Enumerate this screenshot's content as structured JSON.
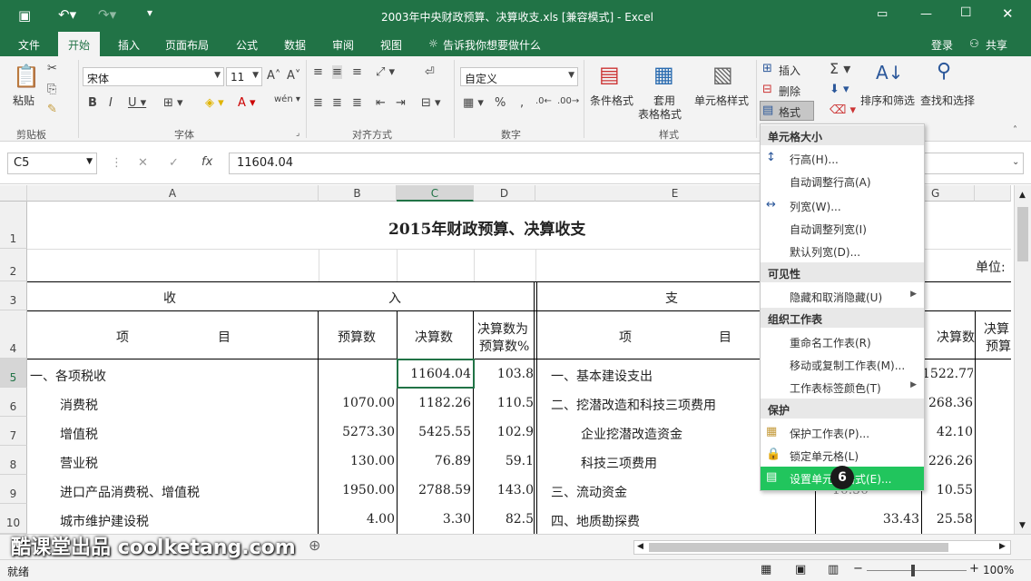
{
  "window": {
    "title": "2003年中央财政预算、决算收支.xls  [兼容模式] - Excel"
  },
  "menu": {
    "tabs": [
      "文件",
      "开始",
      "插入",
      "页面布局",
      "公式",
      "数据",
      "审阅",
      "视图"
    ],
    "tell_me": "告诉我你想要做什么",
    "login": "登录",
    "share": "共享"
  },
  "ribbon": {
    "paste": "粘贴",
    "font_name": "宋体",
    "font_size": "11",
    "number_format": "自定义",
    "conditional_format": "条件格式",
    "table_format_1": "套用",
    "table_format_2": "表格格式",
    "cell_styles": "单元格样式",
    "insert": "插入",
    "delete": "删除",
    "format": "格式",
    "sort_filter": "排序和筛选",
    "find_select": "查找和选择",
    "groups": {
      "clipboard": "剪贴板",
      "font": "字体",
      "alignment": "对齐方式",
      "number": "数字",
      "styles": "样式"
    }
  },
  "formula_bar": {
    "name_box": "C5",
    "value": "11604.04"
  },
  "columns": [
    "A",
    "B",
    "C",
    "D",
    "E",
    "G"
  ],
  "rows": [
    "1",
    "2",
    "3",
    "4",
    "5",
    "6",
    "7",
    "8",
    "9",
    "10"
  ],
  "sheet": {
    "title": "2015年财政预算、决算收支",
    "unit_label": "单位:",
    "income_header_1": "收",
    "income_header_2": "入",
    "expense_header": "支",
    "item_1": "项",
    "item_2": "目",
    "budget": "预算数",
    "actual": "决算数",
    "ratio_1": "决算数为",
    "ratio_2": "预算数%",
    "right_actual": "决算数",
    "right_ratio": "决算",
    "right_ratio_2": "预算",
    "income_rows": [
      {
        "name": "一、各项税收",
        "budget": "",
        "actual": "11604.04",
        "ratio": "103.8"
      },
      {
        "name": "消费税",
        "budget": "1070.00",
        "actual": "1182.26",
        "ratio": "110.5"
      },
      {
        "name": "增值税",
        "budget": "5273.30",
        "actual": "5425.55",
        "ratio": "102.9"
      },
      {
        "name": "营业税",
        "budget": "130.00",
        "actual": "76.89",
        "ratio": "59.1"
      },
      {
        "name": "进口产品消费税、增值税",
        "budget": "1950.00",
        "actual": "2788.59",
        "ratio": "143.0"
      },
      {
        "name": "城市维护建设税",
        "budget": "4.00",
        "actual": "3.30",
        "ratio": "82.5"
      }
    ],
    "expense_rows": [
      {
        "name": "一、基本建设支出",
        "f": "",
        "g": "1522.77"
      },
      {
        "name": "二、挖潜改造和科技三项费用",
        "f": "",
        "g": "268.36"
      },
      {
        "name": "企业挖潜改造资金",
        "f": "",
        "g": "42.10"
      },
      {
        "name": "科技三项费用",
        "f": "",
        "g": "226.26"
      },
      {
        "name": "三、流动资金",
        "f": "10.50",
        "g": "10.55"
      },
      {
        "name": "四、地质勘探费",
        "f": "33.43",
        "g": "25.58"
      }
    ]
  },
  "dropdown": {
    "sec_cell_size": "单元格大小",
    "row_height": "行高(H)...",
    "autofit_row": "自动调整行高(A)",
    "col_width": "列宽(W)...",
    "autofit_col": "自动调整列宽(I)",
    "default_width": "默认列宽(D)...",
    "sec_visibility": "可见性",
    "hide_unhide": "隐藏和取消隐藏(U)",
    "sec_organize": "组织工作表",
    "rename": "重命名工作表(R)",
    "move_copy": "移动或复制工作表(M)...",
    "tab_color": "工作表标签颜色(T)",
    "sec_protect": "保护",
    "protect_sheet": "保护工作表(P)...",
    "lock_cell": "锁定单元格(L)",
    "format_cells": "设置单元格格式(E)..."
  },
  "step_badge": "6",
  "status": {
    "ready": "就绪",
    "zoom": "100%"
  },
  "watermark": "酷课堂出品 coolketang.com",
  "colors": {
    "accent": "#217346",
    "highlight": "#21c55d"
  }
}
